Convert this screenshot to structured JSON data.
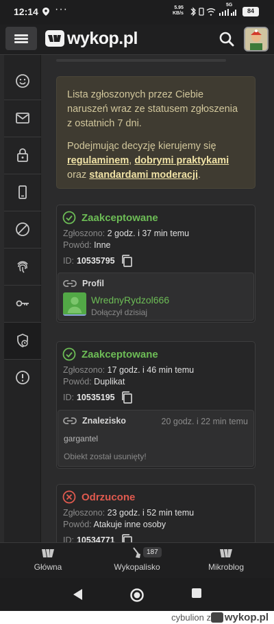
{
  "status_bar": {
    "time": "12:14",
    "dots": "···",
    "net_speed": "5.95",
    "net_unit": "KB/s",
    "signal_label": "5G",
    "battery": "84"
  },
  "header": {
    "logo_text": "wykop.pl"
  },
  "info": {
    "line1": "Lista zgłoszonych przez Ciebie naruszeń wraz ze statusem zgłoszenia z ostatnich 7 dni.",
    "line2_prefix": "Podejmując decyzję kierujemy się ",
    "link_regulamin": "regulaminem",
    "sep": ", ",
    "link_praktyki": "dobrymi praktykami",
    "and": " oraz ",
    "link_standardy": "standardami moderacji",
    "end": "."
  },
  "labels": {
    "reported": "Zgłoszono: ",
    "reason": "Powód: ",
    "id": "ID:"
  },
  "reports": [
    {
      "status": "Zaakceptowane",
      "reported_ago": "2 godz. i 37 min temu",
      "reason": "Inne",
      "id": "10535795",
      "target_type": "Profil",
      "user_name": "WrednyRydzol666",
      "user_joined": "Dołączył dzisiaj"
    },
    {
      "status": "Zaakceptowane",
      "reported_ago": "17 godz. i 46 min temu",
      "reason": "Duplikat",
      "id": "10535195",
      "target_type": "Znalezisko",
      "target_time": "20 godz. i 22 min temu",
      "target_title": "gargantel",
      "target_note": "Obiekt został usunięty!"
    },
    {
      "status": "Odrzucone",
      "reported_ago": "23 godz. i 52 min temu",
      "reason": "Atakuje inne osoby",
      "id": "10534771"
    }
  ],
  "bottom_nav": {
    "home": "Główna",
    "wykopalisko": "Wykopalisko",
    "wykopalisko_badge": "187",
    "mikroblog": "Mikroblog"
  },
  "watermark": {
    "user": "cybulion",
    "z": "z",
    "brand": "wykop.pl"
  },
  "colors": {
    "accepted": "#6dbd56",
    "rejected": "#e05a4f",
    "info_bg": "#3f3b31"
  }
}
